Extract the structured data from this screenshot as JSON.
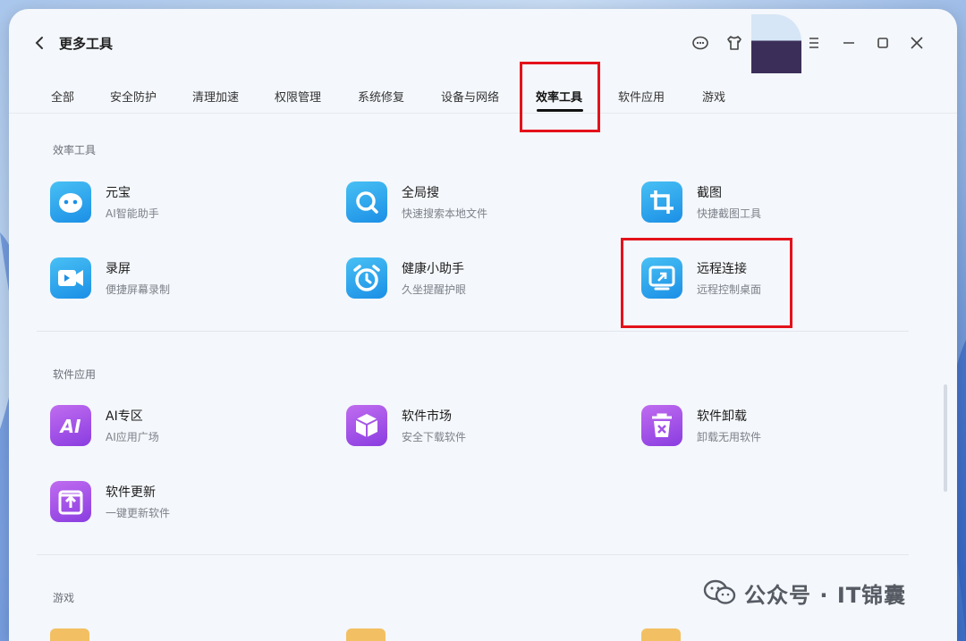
{
  "window": {
    "title": "更多工具"
  },
  "titlebar_icons": [
    "feedback-icon",
    "shirt-icon",
    "menu-icon",
    "minimize-icon",
    "maximize-icon",
    "close-icon"
  ],
  "tabs": [
    {
      "label": "全部",
      "active": false
    },
    {
      "label": "安全防护",
      "active": false
    },
    {
      "label": "清理加速",
      "active": false
    },
    {
      "label": "权限管理",
      "active": false
    },
    {
      "label": "系统修复",
      "active": false
    },
    {
      "label": "设备与网络",
      "active": false
    },
    {
      "label": "效率工具",
      "active": true
    },
    {
      "label": "软件应用",
      "active": false
    },
    {
      "label": "游戏",
      "active": false
    }
  ],
  "sections": {
    "efficiency": {
      "title": "效率工具",
      "items": [
        {
          "name": "元宝",
          "desc": "AI智能助手",
          "icon": "yuanbao-icon"
        },
        {
          "name": "全局搜",
          "desc": "快速搜索本地文件",
          "icon": "search-icon"
        },
        {
          "name": "截图",
          "desc": "快捷截图工具",
          "icon": "crop-icon"
        },
        {
          "name": "录屏",
          "desc": "便捷屏幕录制",
          "icon": "video-icon"
        },
        {
          "name": "健康小助手",
          "desc": "久坐提醒护眼",
          "icon": "alarm-clock-icon"
        },
        {
          "name": "远程连接",
          "desc": "远程控制桌面",
          "icon": "remote-desktop-icon"
        }
      ]
    },
    "software": {
      "title": "软件应用",
      "items": [
        {
          "name": "AI专区",
          "desc": "AI应用广场",
          "icon": "ai-icon"
        },
        {
          "name": "软件市场",
          "desc": "安全下载软件",
          "icon": "box-icon"
        },
        {
          "name": "软件卸载",
          "desc": "卸载无用软件",
          "icon": "trash-icon"
        },
        {
          "name": "软件更新",
          "desc": "一键更新软件",
          "icon": "upload-icon"
        }
      ]
    },
    "games": {
      "title": "游戏"
    }
  },
  "watermark": {
    "text": "公众号 · IT锦囊"
  },
  "colors": {
    "accent_blue": "#1b8fe6",
    "accent_purple": "#8a3de0",
    "highlight_red": "#e3121b"
  }
}
